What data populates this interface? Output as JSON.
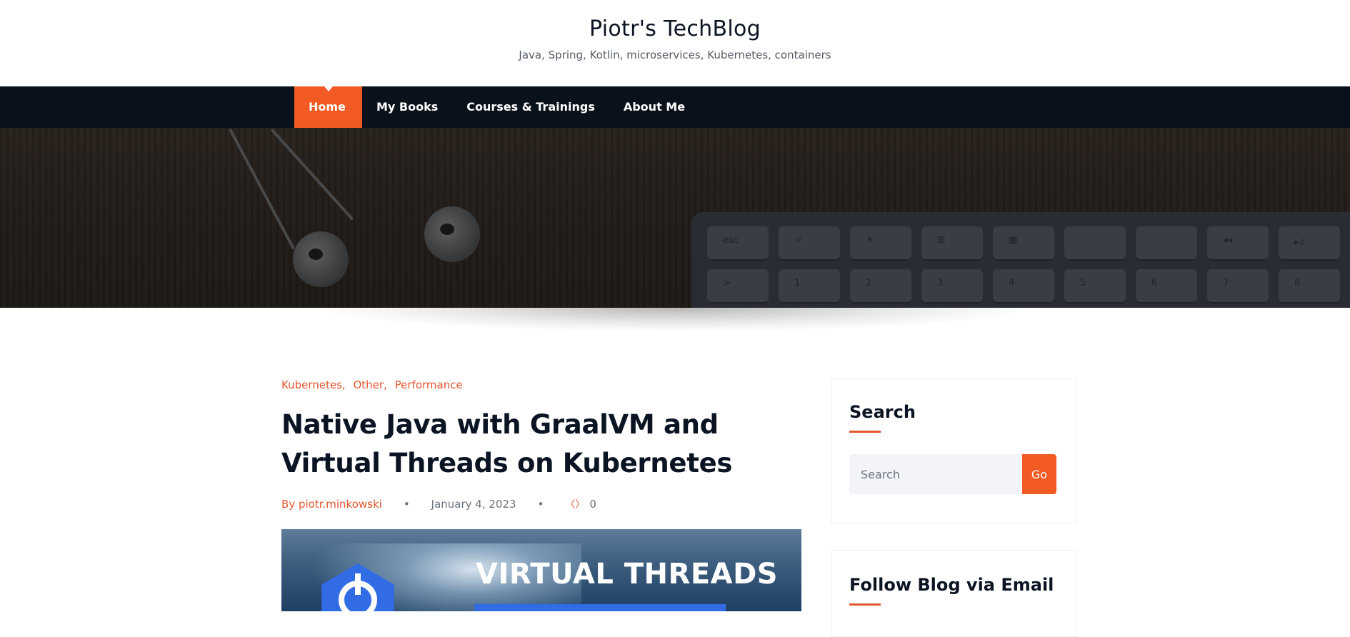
{
  "site": {
    "title": "Piotr's TechBlog",
    "tagline": "Java, Spring, Kotlin, microservices, Kubernetes, containers"
  },
  "nav": {
    "items": [
      {
        "label": "Home",
        "active": true
      },
      {
        "label": "My Books"
      },
      {
        "label": "Courses & Trainings"
      },
      {
        "label": "About Me"
      }
    ]
  },
  "hero": {
    "keys_row1": [
      "esc",
      "☼",
      "☀",
      "⊞",
      "▦",
      "",
      "",
      "◂◂",
      "▸॥"
    ],
    "keys_row2": [
      ">",
      "1",
      "2",
      "3",
      "4",
      "5",
      "6",
      "7",
      "8"
    ]
  },
  "post": {
    "categories": [
      "Kubernetes",
      "Other",
      "Performance"
    ],
    "category_separator": ",",
    "title": "Native Java with GraalVM and Virtual Threads on Kubernetes",
    "author_prefix": "By",
    "author": "piotr.minkowski",
    "date": "January 4, 2023",
    "comments_count": "0",
    "meta_separator": "•",
    "image": {
      "headline": "VIRTUAL THREADS"
    }
  },
  "sidebar": {
    "search": {
      "title": "Search",
      "placeholder": "Search",
      "button_label": "Go"
    },
    "follow": {
      "title": "Follow Blog via Email"
    }
  },
  "colors": {
    "accent": "#f15a22",
    "nav_bg": "#09111b",
    "text_dark": "#0b1423",
    "k8s_blue": "#326ce5"
  },
  "icons": {
    "comment": "comment-icon",
    "kubernetes": "kubernetes-helm-icon"
  }
}
